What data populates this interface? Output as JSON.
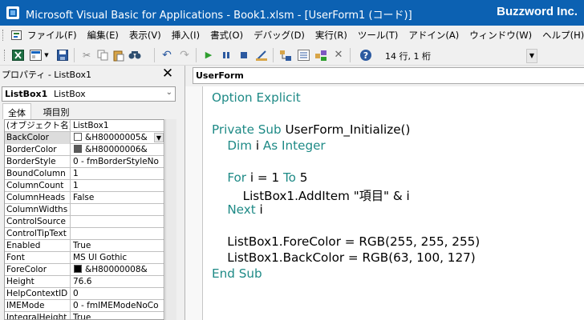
{
  "titlebar": {
    "title": "Microsoft Visual Basic for Applications - Book1.xlsm - [UserForm1 (コード)]",
    "brand": "Buzzword Inc."
  },
  "menubar": {
    "items": [
      "ファイル(F)",
      "編集(E)",
      "表示(V)",
      "挿入(I)",
      "書式(O)",
      "デバッグ(D)",
      "実行(R)",
      "ツール(T)",
      "アドイン(A)",
      "ウィンドウ(W)",
      "ヘルプ(H)"
    ]
  },
  "toolbar": {
    "cursor_position": "14 行, 1 桁",
    "icons": [
      "excel-icon",
      "insert-userform-icon",
      "save-icon",
      "cut-icon",
      "copy-icon",
      "paste-icon",
      "find-icon",
      "undo-icon",
      "redo-icon",
      "run-icon",
      "break-icon",
      "reset-icon",
      "design-mode-icon",
      "project-explorer-icon",
      "properties-icon",
      "object-browser-icon",
      "toolbox-icon",
      "help-icon"
    ]
  },
  "properties": {
    "title": "プロパティ - ListBox1",
    "object_name": "ListBox1",
    "object_type": "ListBox",
    "tabs": [
      "全体",
      "項目別"
    ],
    "rows": [
      {
        "key": "(オブジェクト名)",
        "value": "ListBox1"
      },
      {
        "key": "BackColor",
        "value": "&H80000005&",
        "swatch": "#ffffff",
        "dropdown": true
      },
      {
        "key": "BorderColor",
        "value": "&H80000006&",
        "swatch": "#5a5a5a"
      },
      {
        "key": "BorderStyle",
        "value": "0 - fmBorderStyleNo"
      },
      {
        "key": "BoundColumn",
        "value": "1"
      },
      {
        "key": "ColumnCount",
        "value": "1"
      },
      {
        "key": "ColumnHeads",
        "value": "False"
      },
      {
        "key": "ColumnWidths",
        "value": ""
      },
      {
        "key": "ControlSource",
        "value": ""
      },
      {
        "key": "ControlTipText",
        "value": ""
      },
      {
        "key": "Enabled",
        "value": "True"
      },
      {
        "key": "Font",
        "value": "MS UI Gothic"
      },
      {
        "key": "ForeColor",
        "value": "&H80000008&",
        "swatch": "#000000"
      },
      {
        "key": "Height",
        "value": "76.6"
      },
      {
        "key": "HelpContextID",
        "value": "0"
      },
      {
        "key": "IMEMode",
        "value": "0 - fmIMEModeNoCo"
      },
      {
        "key": "IntegralHeight",
        "value": "True"
      }
    ]
  },
  "code": {
    "object_combo": "UserForm",
    "lines": [
      {
        "parts": [
          {
            "t": "Option Explicit",
            "c": "lnk"
          }
        ]
      },
      {
        "parts": []
      },
      {
        "parts": [
          {
            "t": "Private Sub",
            "c": "lnk"
          },
          {
            "t": " UserForm_Initialize()",
            "c": ""
          }
        ]
      },
      {
        "parts": [
          {
            "t": "    ",
            "c": ""
          },
          {
            "t": "Dim",
            "c": "lnk"
          },
          {
            "t": " i ",
            "c": ""
          },
          {
            "t": "As Integer",
            "c": "lnk"
          }
        ]
      },
      {
        "parts": []
      },
      {
        "parts": [
          {
            "t": "    ",
            "c": ""
          },
          {
            "t": "For",
            "c": "lnk"
          },
          {
            "t": " i = 1 ",
            "c": ""
          },
          {
            "t": "To",
            "c": "lnk"
          },
          {
            "t": " 5",
            "c": ""
          }
        ]
      },
      {
        "parts": [
          {
            "t": "        ListBox1.AddItem \"項目\" & i",
            "c": ""
          }
        ]
      },
      {
        "parts": [
          {
            "t": "    ",
            "c": ""
          },
          {
            "t": "Next",
            "c": "lnk"
          },
          {
            "t": " i",
            "c": ""
          }
        ]
      },
      {
        "parts": []
      },
      {
        "parts": [
          {
            "t": "    ListBox1.ForeColor = RGB(255, 255, 255)",
            "c": ""
          }
        ]
      },
      {
        "parts": [
          {
            "t": "    ListBox1.BackColor = RGB(63, 100, 127)",
            "c": ""
          }
        ]
      },
      {
        "parts": [
          {
            "t": "End Sub",
            "c": "lnk"
          }
        ]
      }
    ]
  },
  "colors": {
    "titlebar": "#0c61b2",
    "keyword": "#1e8a86"
  }
}
